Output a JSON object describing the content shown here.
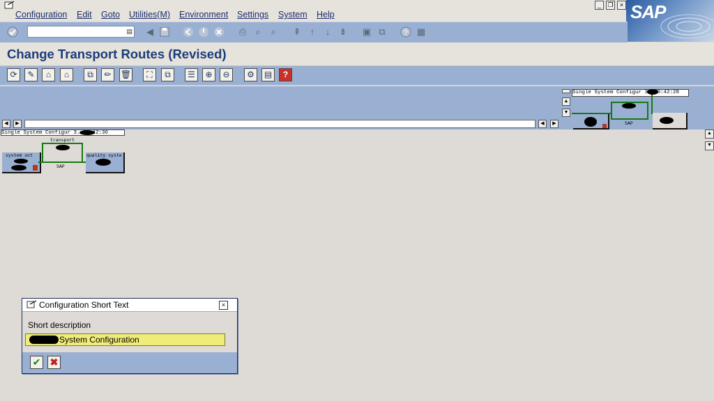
{
  "menu": {
    "items": [
      "Configuration",
      "Edit",
      "Goto",
      "Utilities(M)",
      "Environment",
      "Settings",
      "System",
      "Help"
    ]
  },
  "window_controls": {
    "minimize": "_",
    "restore": "❐",
    "close": "×"
  },
  "logo": {
    "text": "SAP"
  },
  "std_toolbar": {
    "command_field_value": "",
    "icons": [
      "enter-icon",
      "back-icon",
      "save-icon",
      "back-nav-icon",
      "exit-icon",
      "cancel-icon",
      "print-icon",
      "find-icon",
      "find-next-icon",
      "first-page-icon",
      "previous-page-icon",
      "next-page-icon",
      "last-page-icon",
      "create-session-icon",
      "shortcut-icon",
      "help-icon",
      "layout-icon"
    ]
  },
  "page": {
    "title": "Change Transport Routes (Revised)"
  },
  "app_toolbar": {
    "icons": [
      "refresh-icon",
      "display-change-icon",
      "add-system-icon",
      "transport-layer-icon",
      "hierarchy-icon",
      "edit-icon",
      "delete-icon",
      "fit-view-icon",
      "detail-icon",
      "list-icon",
      "zoom-in-icon",
      "zoom-out-icon",
      "settings-icon",
      "legend-icon",
      "help-icon"
    ]
  },
  "overview": {
    "caption": "Single System Configur 3.    00:42:28",
    "sap_label": "SAP"
  },
  "landscape": {
    "caption": "Single System Configur 3.    00:42:36",
    "route_label": "transport",
    "sap_label": "SAP",
    "dev_system_label": "system uct",
    "quality_system_label": "quality syste"
  },
  "dialog": {
    "title": "Configuration Short Text",
    "field_label": "Short description",
    "field_value": "System Configuration",
    "confirm_icon": "checkmark-icon",
    "cancel_icon": "cancel-x-icon"
  },
  "colors": {
    "accent_blue": "#9ab0d2",
    "title_blue": "#1a3c7a",
    "route_green": "#117a11",
    "input_yellow": "#f0ec7a"
  }
}
